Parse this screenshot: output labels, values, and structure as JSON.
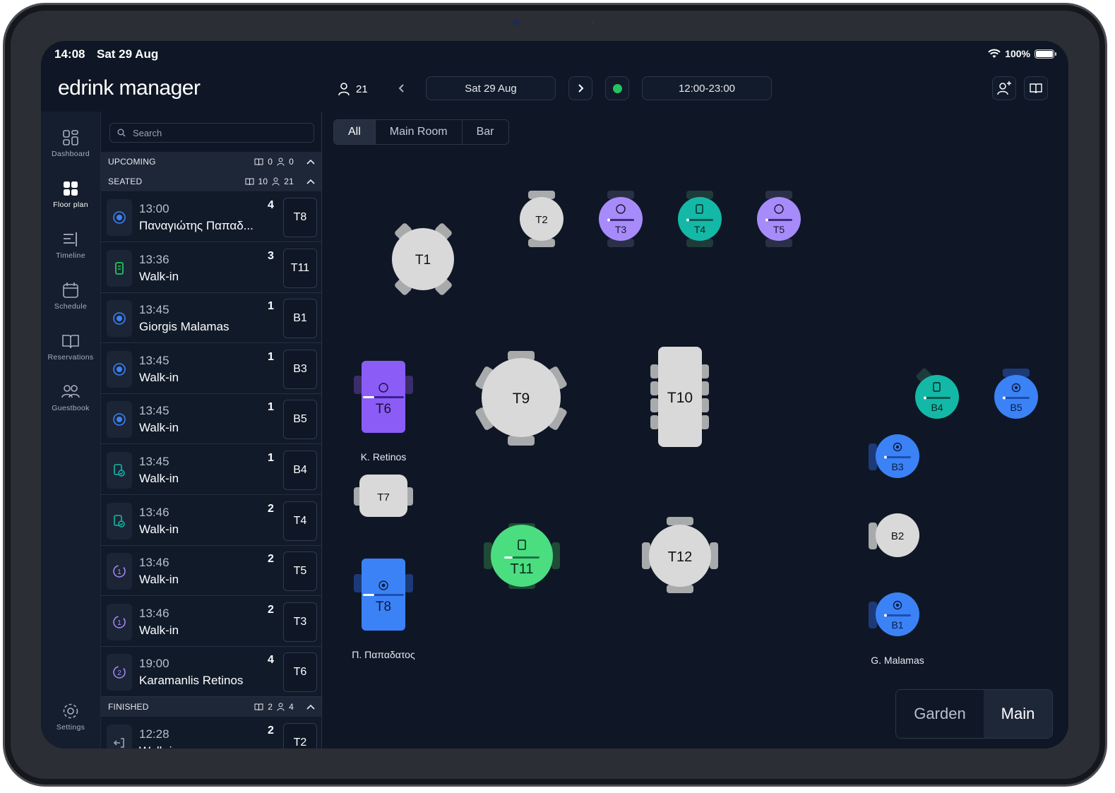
{
  "status_bar": {
    "time": "14:08",
    "date": "Sat 29 Aug",
    "battery": "100%"
  },
  "header": {
    "app_title": "edrink manager",
    "guest_count": "21",
    "date": "Sat 29 Aug",
    "hours": "12:00-23:00",
    "service_status_color": "#22c55e"
  },
  "nav": {
    "dashboard": "Dashboard",
    "floor_plan": "Floor plan",
    "timeline": "Timeline",
    "schedule": "Schedule",
    "reservations": "Reservations",
    "guestbook": "Guestbook",
    "settings": "Settings"
  },
  "search": {
    "placeholder": "Search"
  },
  "sections": {
    "upcoming": {
      "label": "UPCOMING",
      "reservations": "0",
      "guests": "0"
    },
    "seated": {
      "label": "SEATED",
      "reservations": "10",
      "guests": "21"
    },
    "finished": {
      "label": "FINISHED",
      "reservations": "2",
      "guests": "4"
    }
  },
  "seated_rows": [
    {
      "time": "13:00",
      "name": "Παναγιώτης Παπαδ...",
      "count": "4",
      "table": "T8",
      "icon": "target-icon",
      "color": "#3b82f6"
    },
    {
      "time": "13:36",
      "name": "Walk-in",
      "count": "3",
      "table": "T11",
      "icon": "receipt-icon",
      "color": "#22c55e"
    },
    {
      "time": "13:45",
      "name": "Giorgis Malamas",
      "count": "1",
      "table": "B1",
      "icon": "target-icon",
      "color": "#3b82f6"
    },
    {
      "time": "13:45",
      "name": "Walk-in",
      "count": "1",
      "table": "B3",
      "icon": "target-icon",
      "color": "#3b82f6"
    },
    {
      "time": "13:45",
      "name": "Walk-in",
      "count": "1",
      "table": "B5",
      "icon": "target-icon",
      "color": "#3b82f6"
    },
    {
      "time": "13:45",
      "name": "Walk-in",
      "count": "1",
      "table": "B4",
      "icon": "bill-paid-icon",
      "color": "#14b8a6"
    },
    {
      "time": "13:46",
      "name": "Walk-in",
      "count": "2",
      "table": "T4",
      "icon": "bill-paid-icon",
      "color": "#14b8a6"
    },
    {
      "time": "13:46",
      "name": "Walk-in",
      "count": "2",
      "table": "T5",
      "icon": "course-1-icon",
      "color": "#a78bfa"
    },
    {
      "time": "13:46",
      "name": "Walk-in",
      "count": "2",
      "table": "T3",
      "icon": "course-1-icon",
      "color": "#a78bfa"
    },
    {
      "time": "19:00",
      "name": "Karamanlis Retinos",
      "count": "4",
      "table": "T6",
      "icon": "course-2-icon",
      "color": "#a78bfa"
    }
  ],
  "finished_rows": [
    {
      "time": "12:28",
      "name": "Walk-in",
      "count": "2",
      "table": "T2",
      "icon": "exit-icon",
      "color": "#9aa3b3"
    }
  ],
  "room_tabs": [
    "All",
    "Main Room",
    "Bar"
  ],
  "active_room_tab": "All",
  "floor_labels": {
    "t6_guest": "K. Retinos",
    "t8_guest": "Π. Παπαδατος",
    "b1_guest": "G. Malamas"
  },
  "tables": {
    "T1": "T1",
    "T2": "T2",
    "T3": "T3",
    "T4": "T4",
    "T5": "T5",
    "T6": "T6",
    "T7": "T7",
    "T8": "T8",
    "T9": "T9",
    "T10": "T10",
    "T11": "T11",
    "T12": "T12",
    "B1": "B1",
    "B2": "B2",
    "B3": "B3",
    "B4": "B4",
    "B5": "B5"
  },
  "zones": [
    "Garden",
    "Main"
  ],
  "active_zone": "Main",
  "colors": {
    "free": "#d9d9d9",
    "seated_blue": "#3b82f6",
    "course_purple": "#a78bfa",
    "paid_teal": "#14b8a6",
    "ordered_green": "#4ade80",
    "t6_purple": "#8b5cf6"
  }
}
